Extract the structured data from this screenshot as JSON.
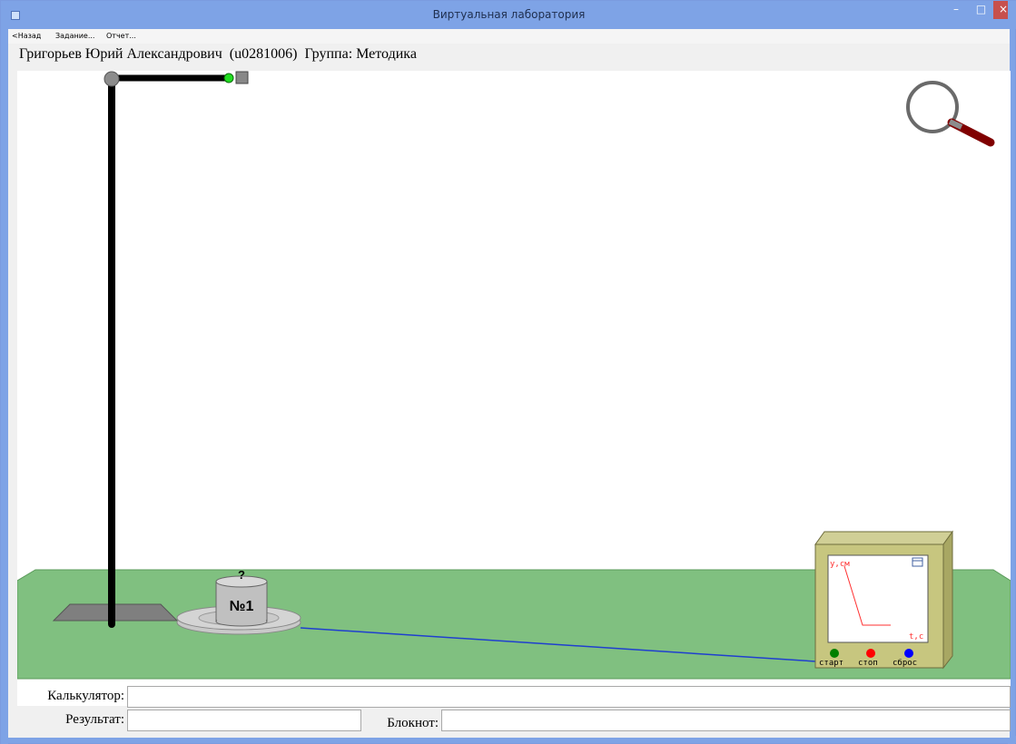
{
  "window": {
    "title": "Виртуальная лаборатория",
    "minimize_glyph": "–",
    "maximize_glyph": "□",
    "close_glyph": "×"
  },
  "menu": {
    "back": "<Назад",
    "task": "Задание...",
    "report": "Отчет..."
  },
  "user": {
    "name": "Григорьев Юрий Александрович",
    "id": "(u0281006)",
    "group": "Группа: Методика"
  },
  "lab": {
    "weight_label": "№1",
    "weight_mark": "?",
    "screen": {
      "y_axis_label": "y,см",
      "t_axis_label": "t,с"
    },
    "buttons": {
      "start": "старт",
      "stop": "стоп",
      "reset": "сброс"
    },
    "colors": {
      "table": "#80c080",
      "stand": "#000000",
      "wire": "#1f3fcf",
      "graph": "#ff3030",
      "start_button": "#008000",
      "stop_button": "#ff0000",
      "reset_button": "#0000ff",
      "magnifier_handle": "#800000"
    }
  },
  "form": {
    "calculator_label": "Калькулятор:",
    "calculator_value": "",
    "result_label": "Результат:",
    "result_value": "",
    "notepad_label": "Блокнот:",
    "notepad_value": ""
  }
}
